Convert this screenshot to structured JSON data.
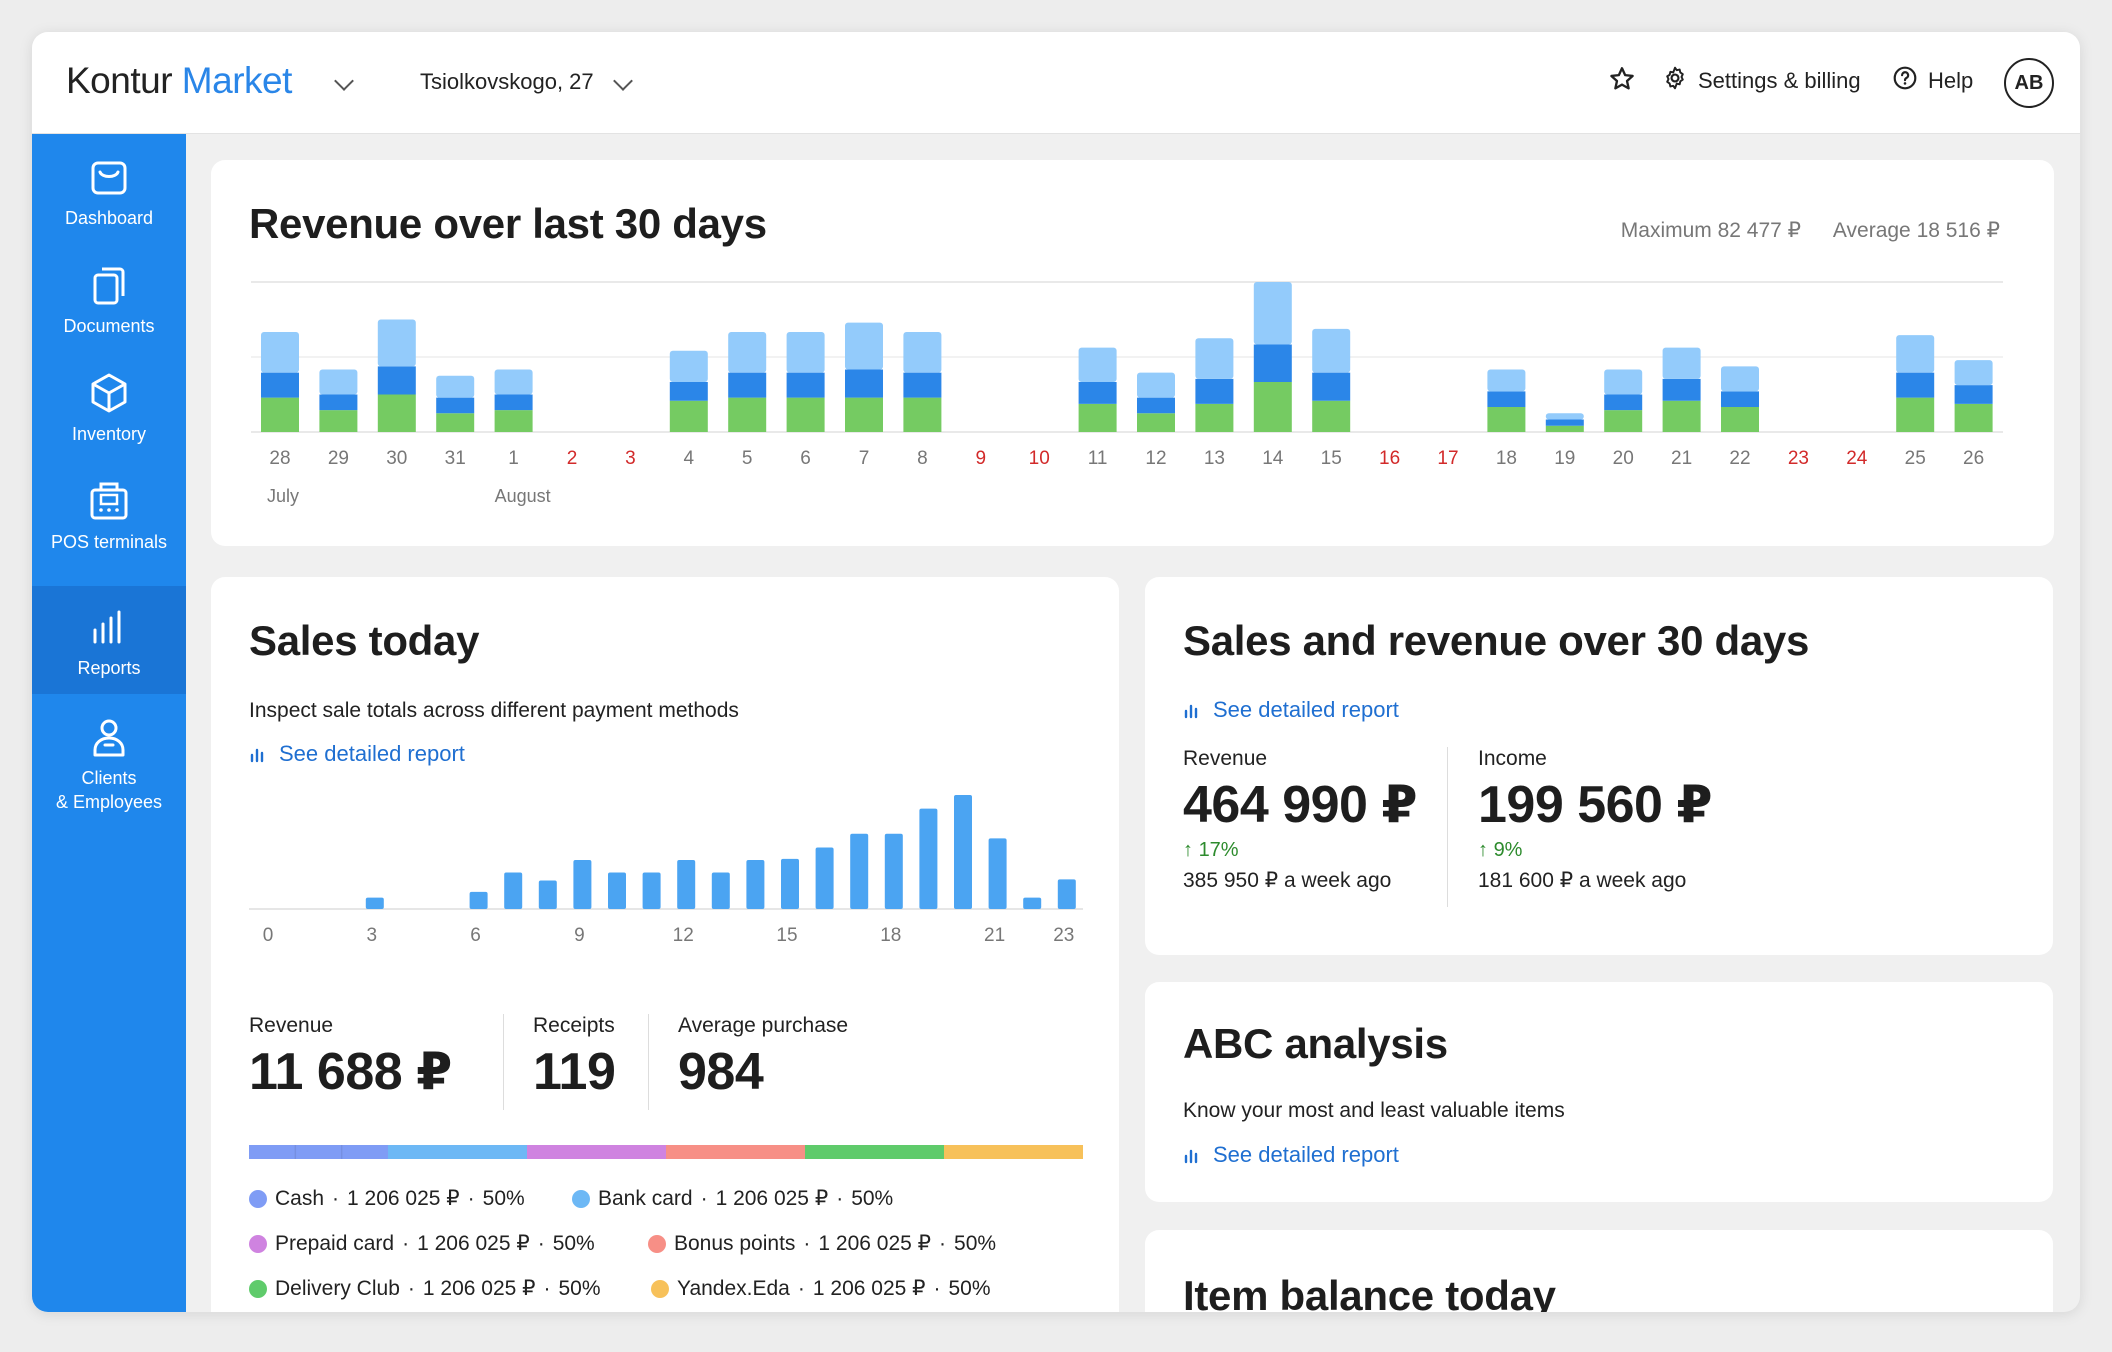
{
  "app": {
    "logo_part1": "Kontur",
    "logo_part2": "Market",
    "store": "Tsiolkovskogo, 27",
    "settings_label": "Settings & billing",
    "help_label": "Help",
    "avatar_initials": "AB",
    "accent": "#1f87ec"
  },
  "sidebar": {
    "items": [
      {
        "label": "Dashboard",
        "icon": "bag-icon"
      },
      {
        "label": "Documents",
        "icon": "documents-icon"
      },
      {
        "label": "Inventory",
        "icon": "box-icon"
      },
      {
        "label": "POS terminals",
        "icon": "pos-terminal-icon"
      },
      {
        "label": "Reports",
        "icon": "bar-chart-icon",
        "active": true
      },
      {
        "label": "Clients",
        "label2": "& Employees",
        "icon": "person-icon"
      }
    ]
  },
  "revenue30": {
    "title": "Revenue over last 30 days",
    "maximum": "Maximum 82 477 ₽",
    "average": "Average 18 516 ₽"
  },
  "sales_today": {
    "title": "Sales today",
    "subtitle": "Inspect sale totals across different payment methods",
    "link": "See detailed report",
    "revenue_label": "Revenue",
    "revenue_value": "11 688 ₽",
    "receipts_label": "Receipts",
    "receipts_value": "119",
    "avg_label": "Average purchase",
    "avg_value": "984",
    "payments": [
      {
        "name": "Cash",
        "amount": "1 206 025 ₽",
        "share": "50%",
        "color": "#7f9cf5"
      },
      {
        "name": "Bank card",
        "amount": "1 206 025 ₽",
        "share": "50%",
        "color": "#6db8f5"
      },
      {
        "name": "Prepaid card",
        "amount": "1 206 025 ₽",
        "share": "50%",
        "color": "#cf83e0"
      },
      {
        "name": "Bonus points",
        "amount": "1 206 025 ₽",
        "share": "50%",
        "color": "#f78f86"
      },
      {
        "name": "Delivery Club",
        "amount": "1 206 025 ₽",
        "share": "50%",
        "color": "#5fcb6b"
      },
      {
        "name": "Yandex.Eda",
        "amount": "1 206 025 ₽",
        "share": "50%",
        "color": "#f7c15a"
      }
    ]
  },
  "sales_revenue30": {
    "title": "Sales and revenue over 30 days",
    "link": "See detailed report",
    "revenue_label": "Revenue",
    "revenue_value": "464 990 ₽",
    "revenue_change": "17%",
    "revenue_prev": "385 950 ₽ a week ago",
    "income_label": "Income",
    "income_value": "199 560 ₽",
    "income_change": "9%",
    "income_prev": "181 600 ₽ a week ago"
  },
  "abc": {
    "title": "ABC analysis",
    "subtitle": "Know your most and least valuable items",
    "link": "See detailed report"
  },
  "item_balance": {
    "title": "Item balance today"
  },
  "chart_data": [
    {
      "type": "bar",
      "stacked": true,
      "categories": [
        "28",
        "29",
        "30",
        "31",
        "1",
        "2",
        "3",
        "4",
        "5",
        "6",
        "7",
        "8",
        "9",
        "10",
        "11",
        "12",
        "13",
        "14",
        "15",
        "16",
        "17",
        "18",
        "19",
        "20",
        "21",
        "22",
        "23",
        "24",
        "25",
        "26"
      ],
      "weekend": [
        false,
        false,
        false,
        false,
        false,
        true,
        true,
        false,
        false,
        false,
        false,
        false,
        true,
        true,
        false,
        false,
        false,
        false,
        false,
        true,
        true,
        false,
        false,
        false,
        false,
        false,
        true,
        true,
        false,
        false
      ],
      "month_labels": [
        {
          "index": 0,
          "label": "July"
        },
        {
          "index": 4,
          "label": "August"
        }
      ],
      "ymax": 24,
      "series": [
        {
          "values": [
            5.5,
            3.5,
            6,
            3,
            3.5,
            0,
            0,
            5,
            5.5,
            5.5,
            5.5,
            5.5,
            0,
            0,
            4.5,
            3,
            4.5,
            8,
            5,
            0,
            0,
            4,
            1,
            3.5,
            5,
            4,
            0,
            0,
            5.5,
            4.5
          ],
          "color": "#75cb62"
        },
        {
          "values": [
            4,
            2.5,
            4.5,
            2.5,
            2.5,
            0,
            0,
            3,
            4,
            4,
            4.5,
            4,
            0,
            0,
            3.5,
            2.5,
            4,
            6,
            4.5,
            0,
            0,
            2.5,
            1,
            2.5,
            3.5,
            2.5,
            0,
            0,
            4,
            3
          ],
          "color": "#2b86e8"
        },
        {
          "values": [
            6.5,
            4,
            7.5,
            3.5,
            4,
            0,
            0,
            5,
            6.5,
            6.5,
            7.5,
            6.5,
            0,
            0,
            5.5,
            4,
            6.5,
            10,
            7,
            0,
            0,
            3.5,
            1,
            4,
            5,
            4,
            0,
            0,
            6,
            4
          ],
          "color": "#93cbfb"
        }
      ]
    },
    {
      "type": "bar",
      "x": [
        0,
        1,
        2,
        3,
        4,
        5,
        6,
        7,
        8,
        9,
        10,
        11,
        12,
        13,
        14,
        15,
        16,
        17,
        18,
        19,
        20,
        21,
        22,
        23
      ],
      "x_ticks": [
        "0",
        "3",
        "6",
        "9",
        "12",
        "15",
        "18",
        "21",
        "23"
      ],
      "values": [
        0,
        0,
        0,
        1,
        0,
        0,
        1.5,
        3.2,
        2.5,
        4.3,
        3.2,
        3.2,
        4.3,
        3.2,
        4.3,
        4.4,
        5.4,
        6.6,
        6.6,
        8.8,
        10,
        6.2,
        1,
        2.6
      ],
      "ymax": 10,
      "color": "#4ba4f2"
    }
  ]
}
